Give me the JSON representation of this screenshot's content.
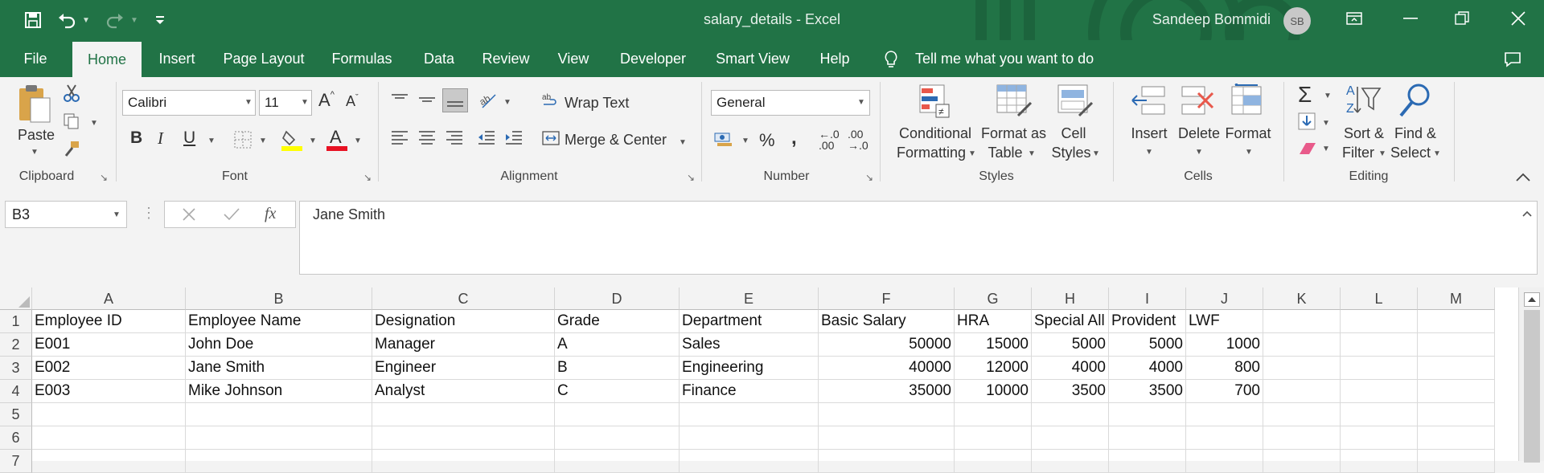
{
  "window": {
    "title": "salary_details  -  Excel",
    "user_name": "Sandeep Bommidi",
    "user_initials": "SB"
  },
  "tabs": [
    "File",
    "Home",
    "Insert",
    "Page Layout",
    "Formulas",
    "Data",
    "Review",
    "View",
    "Developer",
    "Smart View",
    "Help"
  ],
  "active_tab": "Home",
  "tell_me": "Tell me what you want to do",
  "ribbon": {
    "clipboard": {
      "label": "Clipboard",
      "paste": "Paste"
    },
    "font": {
      "label": "Font",
      "name": "Calibri",
      "size": "11"
    },
    "alignment": {
      "label": "Alignment",
      "wrap_text": "Wrap Text",
      "merge_center": "Merge & Center"
    },
    "number": {
      "label": "Number",
      "format": "General"
    },
    "styles": {
      "label": "Styles",
      "conditional_1": "Conditional",
      "conditional_2": "Formatting",
      "format_table_1": "Format as",
      "format_table_2": "Table",
      "cell_styles_1": "Cell",
      "cell_styles_2": "Styles"
    },
    "cells": {
      "label": "Cells",
      "insert": "Insert",
      "delete": "Delete",
      "format": "Format"
    },
    "editing": {
      "label": "Editing",
      "sort_filter_1": "Sort &",
      "sort_filter_2": "Filter",
      "find_select_1": "Find &",
      "find_select_2": "Select"
    }
  },
  "name_box": "B3",
  "formula_value": "Jane Smith",
  "columns": [
    "A",
    "B",
    "C",
    "D",
    "E",
    "F",
    "G",
    "H",
    "I",
    "J",
    "K",
    "L",
    "M"
  ],
  "rows": [
    "1",
    "2",
    "3",
    "4",
    "5",
    "6",
    "7"
  ],
  "sheet": {
    "headers": [
      "Employee ID",
      "Employee Name",
      "Designation",
      "Grade",
      "Department",
      "Basic Salary",
      "HRA",
      "Special All",
      "Provident",
      "LWF"
    ],
    "data": [
      [
        "E001",
        "John Doe",
        "Manager",
        "A",
        "Sales",
        "50000",
        "15000",
        "5000",
        "5000",
        "1000"
      ],
      [
        "E002",
        "Jane Smith",
        "Engineer",
        "B",
        "Engineering",
        "40000",
        "12000",
        "4000",
        "4000",
        "800"
      ],
      [
        "E003",
        "Mike Johnson",
        "Analyst",
        "C",
        "Finance",
        "35000",
        "10000",
        "3500",
        "3500",
        "700"
      ]
    ]
  },
  "colors": {
    "brand": "#217346",
    "font_color_bar": "#e81123",
    "highlight_bar": "#ffff00"
  }
}
